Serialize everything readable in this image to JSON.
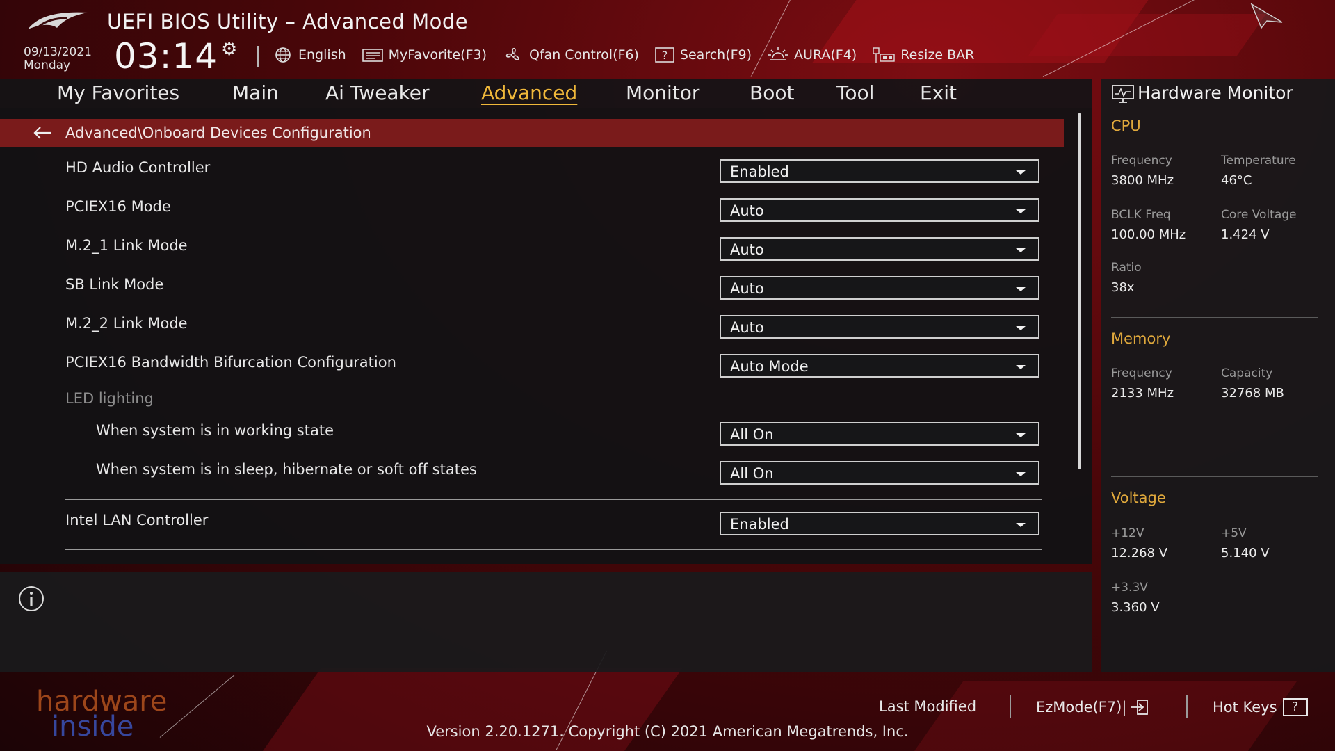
{
  "header": {
    "app_title": "UEFI BIOS Utility – Advanced Mode",
    "date": "09/13/2021",
    "day": "Monday",
    "time": "03:14",
    "toolbar": [
      {
        "label": "English",
        "icon": "globe-icon"
      },
      {
        "label": "MyFavorite(F3)",
        "icon": "favorite-icon"
      },
      {
        "label": "Qfan Control(F6)",
        "icon": "fan-icon"
      },
      {
        "label": "Search(F9)",
        "icon": "search-icon"
      },
      {
        "label": "AURA(F4)",
        "icon": "aura-icon"
      },
      {
        "label": "Resize BAR",
        "icon": "resize-bar-icon"
      }
    ]
  },
  "nav": {
    "tabs": [
      "My Favorites",
      "Main",
      "Ai Tweaker",
      "Advanced",
      "Monitor",
      "Boot",
      "Tool",
      "Exit"
    ],
    "active": "Advanced"
  },
  "main": {
    "breadcrumb": "Advanced\\Onboard Devices Configuration",
    "rows": [
      {
        "label": "HD Audio Controller",
        "value": "Enabled"
      },
      {
        "label": "PCIEX16 Mode",
        "value": "Auto"
      },
      {
        "label": "M.2_1 Link Mode",
        "value": "Auto"
      },
      {
        "label": "SB Link Mode",
        "value": "Auto"
      },
      {
        "label": "M.2_2 Link Mode",
        "value": "Auto"
      },
      {
        "label": "PCIEX16 Bandwidth Bifurcation Configuration",
        "value": "Auto Mode"
      }
    ],
    "led_section": "LED lighting",
    "led_rows": [
      {
        "label": "When system is in working state",
        "value": "All On"
      },
      {
        "label": "When system is in sleep, hibernate or soft off states",
        "value": "All On"
      }
    ],
    "lan_row": {
      "label": "Intel LAN Controller",
      "value": "Enabled"
    }
  },
  "hardware_monitor": {
    "title": "Hardware Monitor",
    "cpu": {
      "title": "CPU",
      "frequency_label": "Frequency",
      "frequency": "3800 MHz",
      "temperature_label": "Temperature",
      "temperature": "46°C",
      "bclk_label": "BCLK Freq",
      "bclk": "100.00 MHz",
      "core_voltage_label": "Core Voltage",
      "core_voltage": "1.424 V",
      "ratio_label": "Ratio",
      "ratio": "38x"
    },
    "memory": {
      "title": "Memory",
      "frequency_label": "Frequency",
      "frequency": "2133 MHz",
      "capacity_label": "Capacity",
      "capacity": "32768 MB"
    },
    "voltage": {
      "title": "Voltage",
      "v12_label": "+12V",
      "v12": "12.268 V",
      "v5_label": "+5V",
      "v5": "5.140 V",
      "v33_label": "+3.3V",
      "v33": "3.360 V"
    }
  },
  "footer": {
    "last_modified": "Last Modified",
    "ezmode": "EzMode(F7)|",
    "hot_keys": "Hot Keys",
    "hot_keys_glyph": "?",
    "version": "Version 2.20.1271. Copyright (C) 2021 American Megatrends, Inc.",
    "watermark_line1": "hardware",
    "watermark_line2": "inside"
  },
  "colors": {
    "accent": "#f0b83a",
    "breadcrumb_bg": "#7a1b1b",
    "section_title": "#e0a93c"
  }
}
